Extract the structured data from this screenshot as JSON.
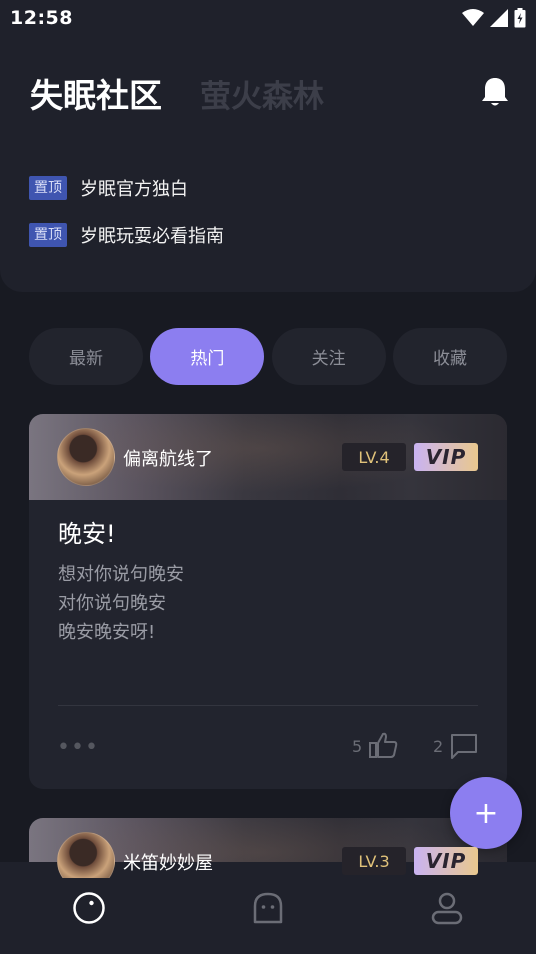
{
  "status_bar": {
    "time": "12:58",
    "icons": [
      "wifi-icon",
      "signal-icon",
      "battery-icon"
    ]
  },
  "header": {
    "tabs": [
      {
        "label": "失眠社区",
        "active": true
      },
      {
        "label": "萤火森林",
        "active": false
      }
    ],
    "notification_icon": "bell-icon"
  },
  "pinned": [
    {
      "badge": "置顶",
      "title": "岁眠官方独白"
    },
    {
      "badge": "置顶",
      "title": "岁眠玩耍必看指南"
    }
  ],
  "filter_tabs": [
    {
      "label": "最新",
      "active": false
    },
    {
      "label": "热门",
      "active": true
    },
    {
      "label": "关注",
      "active": false
    },
    {
      "label": "收藏",
      "active": false
    }
  ],
  "posts": [
    {
      "username": "偏离航线了",
      "level": "LV.4",
      "vip": "VIP",
      "title": "晚安!",
      "body_lines": [
        "想对你说句晚安",
        "对你说句晚安",
        "晚安晚安呀!"
      ],
      "more": "•••",
      "likes": "5",
      "comments": "2"
    },
    {
      "username": "米笛妙妙屋",
      "level": "LV.3",
      "vip": "VIP"
    }
  ],
  "fab": {
    "icon": "plus-icon",
    "label": "+"
  },
  "bottom_nav": [
    {
      "icon": "home-planet-icon",
      "active": true
    },
    {
      "icon": "ghost-icon",
      "active": false
    },
    {
      "icon": "profile-icon",
      "active": false
    }
  ],
  "colors": {
    "accent": "#8c7ef0",
    "background": "#181a22",
    "panel": "#1f212b",
    "pin_badge": "#3f55b0"
  }
}
